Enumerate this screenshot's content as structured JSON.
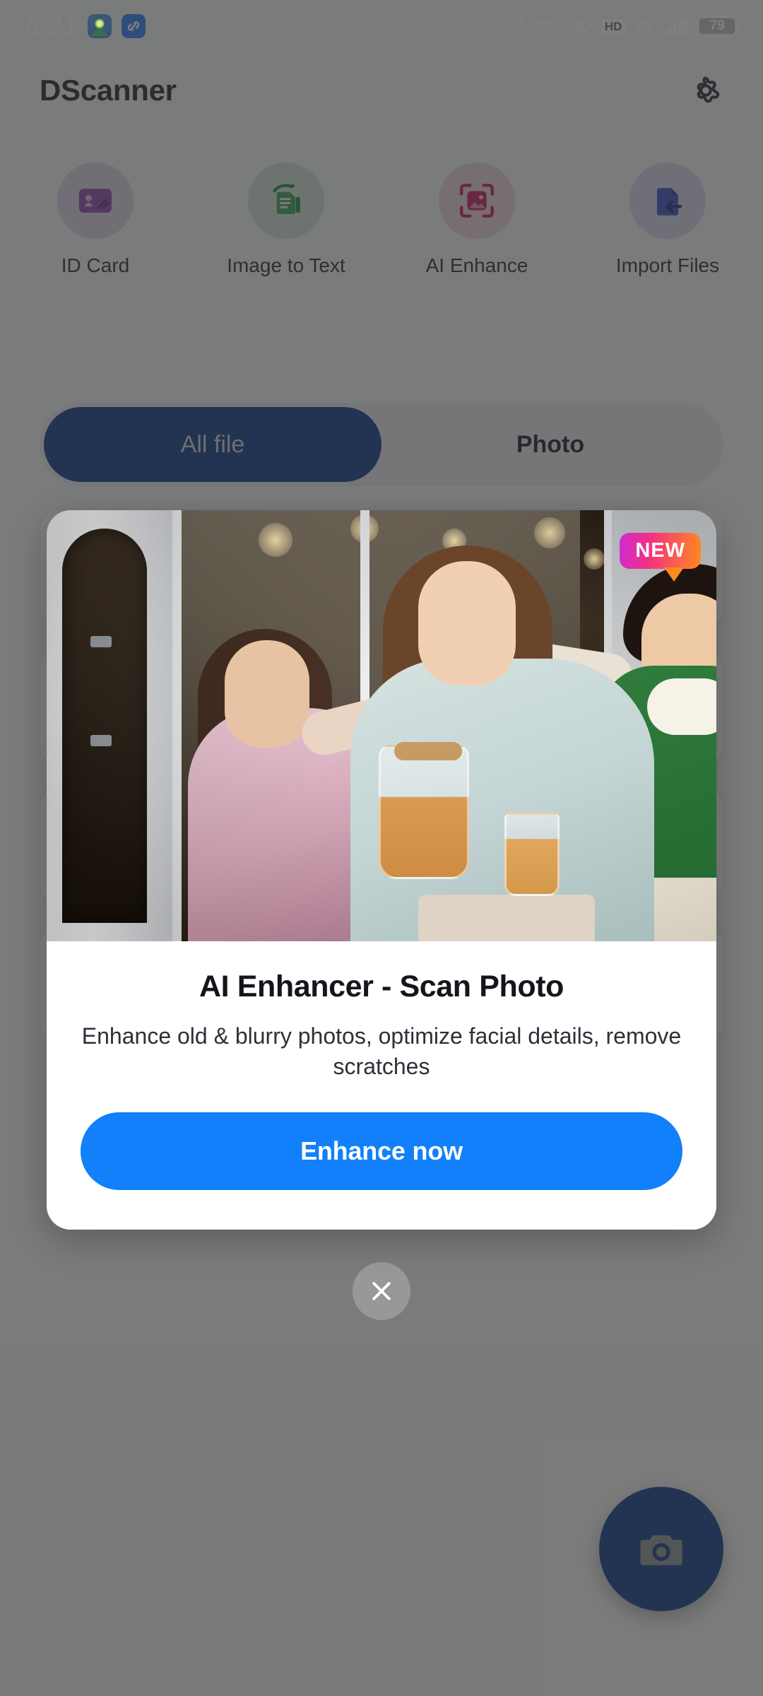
{
  "status_bar": {
    "time": "6:21",
    "left_icons": [
      {
        "name": "maps-app-icon"
      },
      {
        "name": "link-app-icon"
      }
    ],
    "network_speed_value": "0.31",
    "network_speed_unit": "KB/s",
    "icons": [
      {
        "name": "link-icon"
      },
      {
        "name": "bell-muted-icon"
      }
    ],
    "hd_badge": "HD",
    "network_type": "4G",
    "signal_bars": 5,
    "battery_level": "79"
  },
  "header": {
    "title": "DScanner",
    "settings_icon": "gear-icon"
  },
  "quick_actions": [
    {
      "label": "ID Card",
      "icon": "id-card-icon",
      "circle_color": "#b49ac9",
      "icon_color": "#8e44ad"
    },
    {
      "label": "Image to Text",
      "icon": "image-to-text-icon",
      "circle_color": "#97c9a3",
      "icon_color": "#1f8a3f"
    },
    {
      "label": "AI Enhance",
      "icon": "ai-enhance-icon",
      "circle_color": "#d4a0ad",
      "icon_color": "#c2185b"
    },
    {
      "label": "Import Files",
      "icon": "import-files-icon",
      "circle_color": "#9aa5d6",
      "icon_color": "#3b4fc4"
    }
  ],
  "tabs": [
    {
      "label": "All file",
      "active": true
    },
    {
      "label": "Photo",
      "active": false
    }
  ],
  "fab": {
    "icon": "camera-icon",
    "color": "#0c3c86"
  },
  "promo": {
    "badge": "NEW",
    "title": "AI Enhancer - Scan Photo",
    "description": "Enhance old & blurry photos, optimize facial details, remove scratches",
    "cta_label": "Enhance now",
    "cta_color": "#1180fa",
    "image_alt": "three-friends-at-cafe-photo"
  },
  "dismiss": {
    "icon": "close-icon"
  }
}
